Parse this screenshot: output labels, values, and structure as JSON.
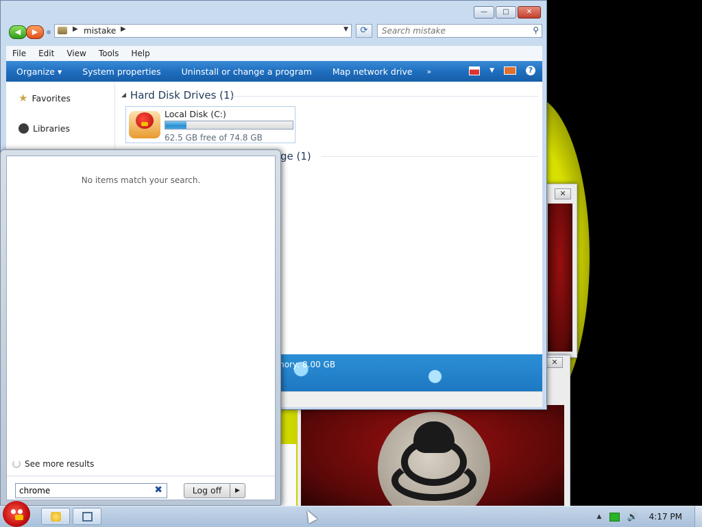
{
  "explorer": {
    "address": {
      "crumb": "mistake"
    },
    "search": {
      "placeholder": "Search mistake"
    },
    "menu": [
      "File",
      "Edit",
      "View",
      "Tools",
      "Help"
    ],
    "commands": [
      "Organize",
      "System properties",
      "Uninstall or change a program",
      "Map network drive"
    ],
    "more_commands": "»",
    "nav": {
      "favorites": "Favorites",
      "libraries": "Libraries"
    },
    "groups": {
      "hard_disk": "Hard Disk Drives (1)",
      "storage_partial": "ge (1)"
    },
    "drive": {
      "name": "Local Disk (C:)",
      "free_text": "62.5 GB free of 74.8 GB",
      "used_fraction": 0.164
    },
    "details": {
      "memory_partial": "mory: 8.00 GB"
    },
    "colors": {
      "command_bar": "#1f6fc0",
      "details_pane": "#2b8fd6"
    }
  },
  "start_menu": {
    "no_results": "No items match your search.",
    "see_more": "See more results",
    "search_value": "chrome",
    "log_off": "Log off"
  },
  "taskbar": {
    "clock": "4:17 PM",
    "pinned": [
      {
        "name": "explorer-icon"
      },
      {
        "name": "window-switch-icon"
      }
    ]
  },
  "background_windows": {
    "close_glyph": "✕"
  }
}
